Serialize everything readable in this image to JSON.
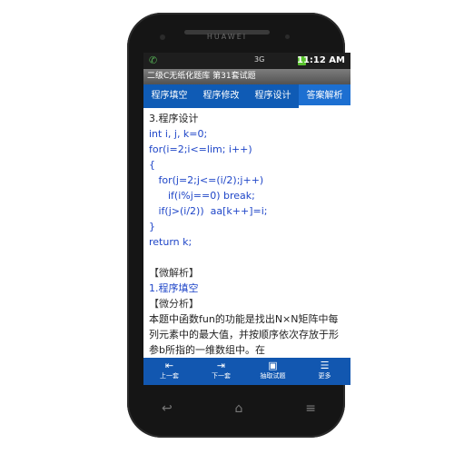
{
  "device": {
    "brand": "HUAWEI"
  },
  "status_bar": {
    "notification_icon": "phone-handset-icon",
    "signal": "3G",
    "time": "11:12 AM"
  },
  "app_title": "二级C无纸化题库 第31套试题",
  "tabs": [
    {
      "label": "程序填空",
      "active": false
    },
    {
      "label": "程序修改",
      "active": false
    },
    {
      "label": "程序设计",
      "active": false
    },
    {
      "label": "答案解析",
      "active": true
    }
  ],
  "content": {
    "section_heading": "3.程序设计",
    "code_lines": [
      "int i, j, k=0;",
      "for(i=2;i<=lim; i++)",
      "{",
      "   for(j=2;j<=(i/2);j++)",
      "      if(i%j==0) break;",
      "   if(j>(i/2))  aa[k++]=i;",
      "}",
      "return k;"
    ],
    "micro_analysis_heading": "【微解析】",
    "item_link": "1.程序填空",
    "micro_breakdown_heading": "【微分析】",
    "body_text": "本题中函数fun的功能是找出N×N矩阵中每列元素中的最大值，并按顺序依次存放于形参b所指的一维数组中。在"
  },
  "bottom_bar": [
    {
      "label": "上一套",
      "icon": "prev-set-icon"
    },
    {
      "label": "下一套",
      "icon": "next-set-icon"
    },
    {
      "label": "抽取试题",
      "icon": "draw-questions-icon"
    },
    {
      "label": "更多",
      "icon": "more-icon"
    }
  ],
  "colors": {
    "tab_bar": "#0f5bb5",
    "code_text": "#1f46c8",
    "status_bar": "#1e1e1e"
  }
}
